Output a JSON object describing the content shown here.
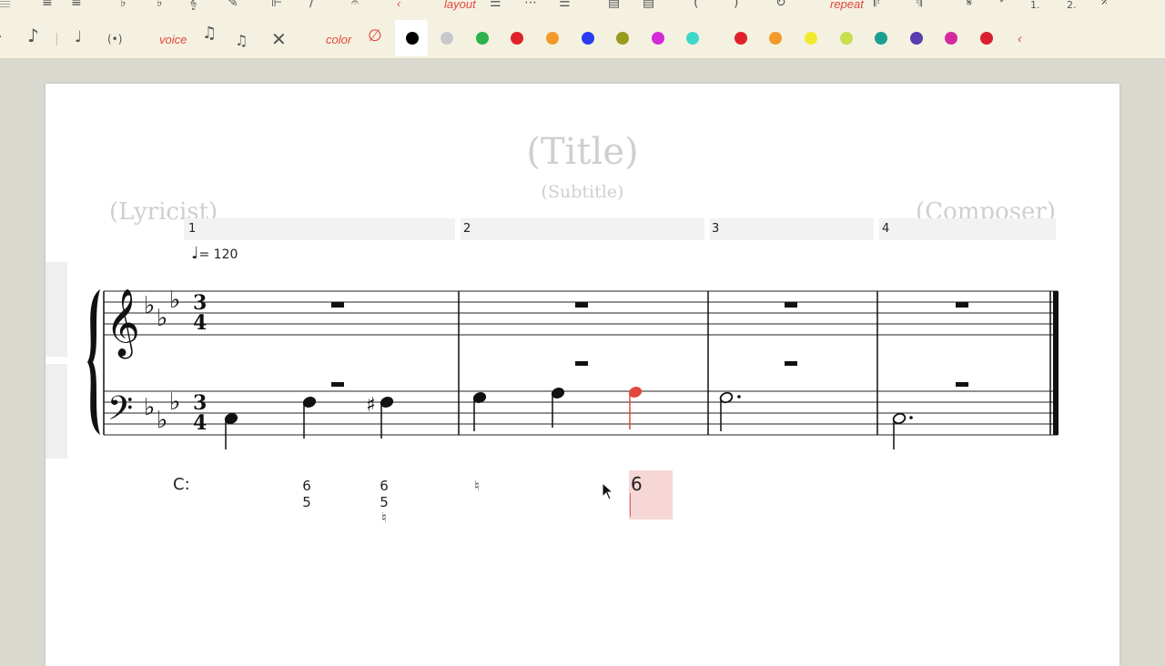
{
  "toolbar": {
    "row1": {
      "layout_label": "layout",
      "repeat_label": "repeat",
      "ending1": "1.",
      "ending2": "2."
    },
    "row2": {
      "voice_label": "voice",
      "color_label": "color",
      "more_arrow": "‹",
      "colors": [
        {
          "name": "black",
          "hex": "#000000",
          "selected": true
        },
        {
          "name": "silver",
          "hex": "#c8c8cc"
        },
        {
          "name": "green",
          "hex": "#2bb24c"
        },
        {
          "name": "red",
          "hex": "#e0202a"
        },
        {
          "name": "orange",
          "hex": "#f39a28"
        },
        {
          "name": "blue",
          "hex": "#2a3cf0"
        },
        {
          "name": "olive",
          "hex": "#9a9a1c"
        },
        {
          "name": "magenta",
          "hex": "#d42ad8"
        },
        {
          "name": "turquoise",
          "hex": "#3fd8c8"
        },
        {
          "name": "crimson",
          "hex": "#e0202a"
        },
        {
          "name": "orange2",
          "hex": "#f39a28"
        },
        {
          "name": "yellow",
          "hex": "#f0ea2c"
        },
        {
          "name": "lime",
          "hex": "#c8e050"
        },
        {
          "name": "teal",
          "hex": "#1aa090"
        },
        {
          "name": "purple",
          "hex": "#5a3cb0"
        },
        {
          "name": "pink",
          "hex": "#d42aa0"
        },
        {
          "name": "red2",
          "hex": "#d8202e"
        }
      ]
    }
  },
  "score": {
    "title": "(Title)",
    "subtitle": "(Subtitle)",
    "lyricist": "(Lyricist)",
    "composer": "(Composer)",
    "tempo_value": "= 120",
    "measures": [
      "1",
      "2",
      "3",
      "4"
    ],
    "time_sig_top": "3",
    "time_sig_bottom": "4",
    "note_accent_color": "#e0483e"
  },
  "figured_bass": {
    "chord_label": "C:",
    "figures": [
      {
        "top": "6",
        "mid": "5",
        "bot": ""
      },
      {
        "top": "6",
        "mid": "5",
        "bot": "♮"
      },
      {
        "top": "♮",
        "mid": "",
        "bot": ""
      }
    ],
    "editing_value": "6"
  }
}
